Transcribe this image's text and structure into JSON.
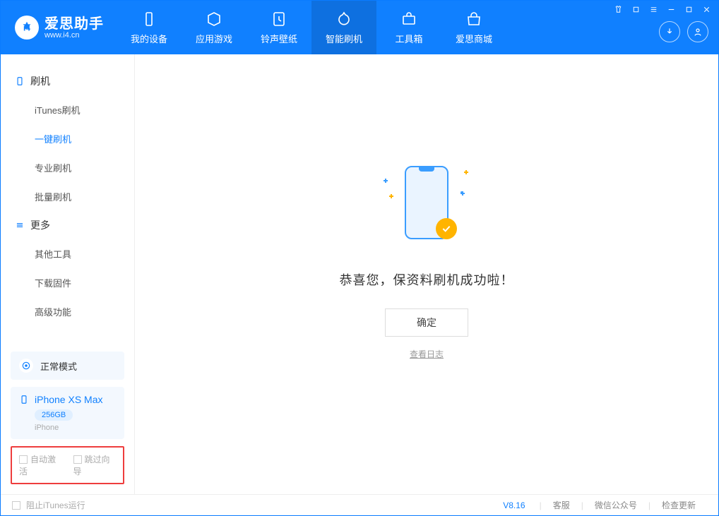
{
  "logo": {
    "title": "爱思助手",
    "subtitle": "www.i4.cn"
  },
  "nav": [
    {
      "label": "我的设备"
    },
    {
      "label": "应用游戏"
    },
    {
      "label": "铃声壁纸"
    },
    {
      "label": "智能刷机"
    },
    {
      "label": "工具箱"
    },
    {
      "label": "爱思商城"
    }
  ],
  "sidebar": {
    "section1": "刷机",
    "items1": [
      "iTunes刷机",
      "一键刷机",
      "专业刷机",
      "批量刷机"
    ],
    "section2": "更多",
    "items2": [
      "其他工具",
      "下载固件",
      "高级功能"
    ]
  },
  "mode": {
    "label": "正常模式"
  },
  "device": {
    "name": "iPhone XS Max",
    "capacity": "256GB",
    "type": "iPhone"
  },
  "options": {
    "autoActivate": "自动激活",
    "skipGuide": "跳过向导"
  },
  "main": {
    "successTitle": "恭喜您，保资料刷机成功啦！",
    "okBtn": "确定",
    "viewLog": "查看日志"
  },
  "footer": {
    "blockItunes": "阻止iTunes运行",
    "version": "V8.16",
    "links": [
      "客服",
      "微信公众号",
      "检查更新"
    ]
  }
}
